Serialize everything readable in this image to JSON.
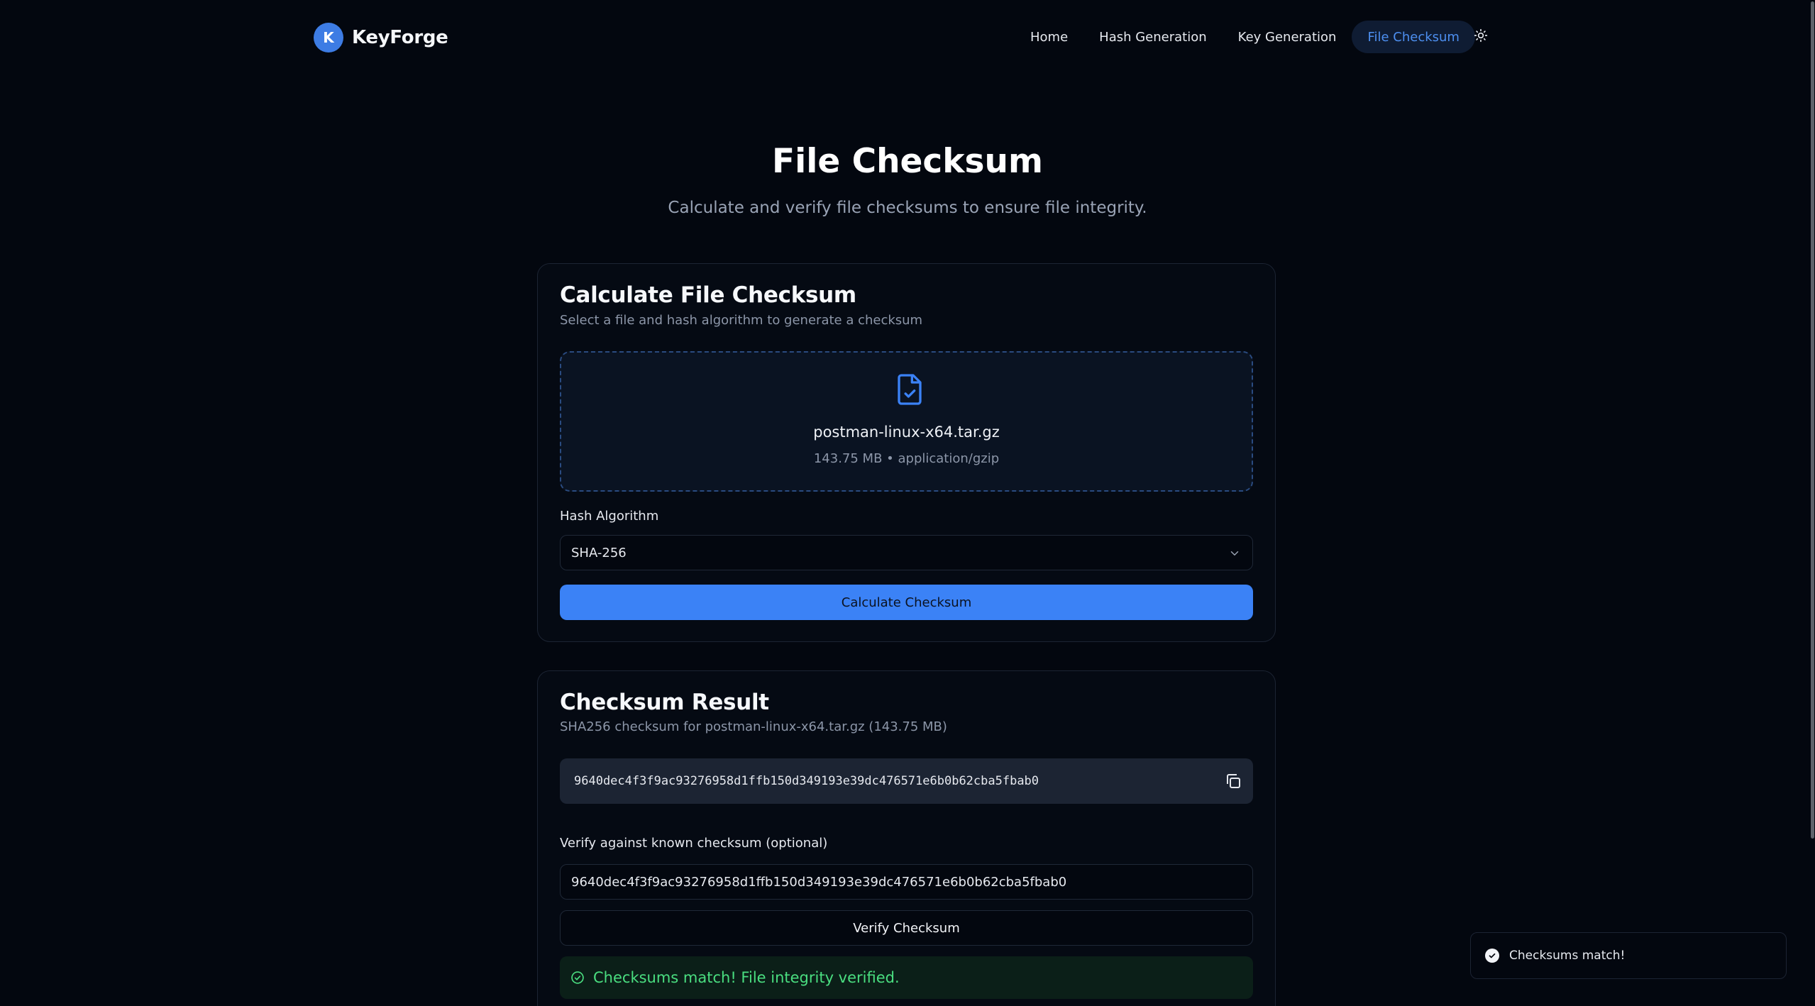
{
  "brand": {
    "logo_letter": "K",
    "name": "KeyForge"
  },
  "nav": {
    "items": [
      {
        "label": "Home"
      },
      {
        "label": "Hash Generation"
      },
      {
        "label": "Key Generation"
      },
      {
        "label": "File Checksum",
        "active": true
      }
    ],
    "theme_icon": "sun-icon"
  },
  "page": {
    "title": "File Checksum",
    "subtitle": "Calculate and verify file checksums to ensure file integrity."
  },
  "calculate": {
    "title": "Calculate File Checksum",
    "description": "Select a file and hash algorithm to generate a checksum",
    "file_icon": "file-check-icon",
    "file_name": "postman-linux-x64.tar.gz",
    "file_meta": "143.75 MB • application/gzip",
    "algorithm_label": "Hash Algorithm",
    "algorithm_value": "SHA-256",
    "button_label": "Calculate Checksum"
  },
  "result": {
    "title": "Checksum Result",
    "description": "SHA256 checksum for postman-linux-x64.tar.gz (143.75 MB)",
    "hash": "9640dec4f3f9ac93276958d1ffb150d349193e39dc476571e6b0b62cba5fbab0",
    "copy_icon": "copy-icon",
    "verify_label": "Verify against known checksum (optional)",
    "verify_value": "9640dec4f3f9ac93276958d1ffb150d349193e39dc476571e6b0b62cba5fbab0",
    "verify_button": "Verify Checksum",
    "success_message": "Checksums match! File integrity verified."
  },
  "toast": {
    "message": "Checksums match!"
  },
  "colors": {
    "background": "#03070f",
    "accent": "#3b82f6",
    "success": "#4ade80",
    "card_border": "#1c2433"
  }
}
